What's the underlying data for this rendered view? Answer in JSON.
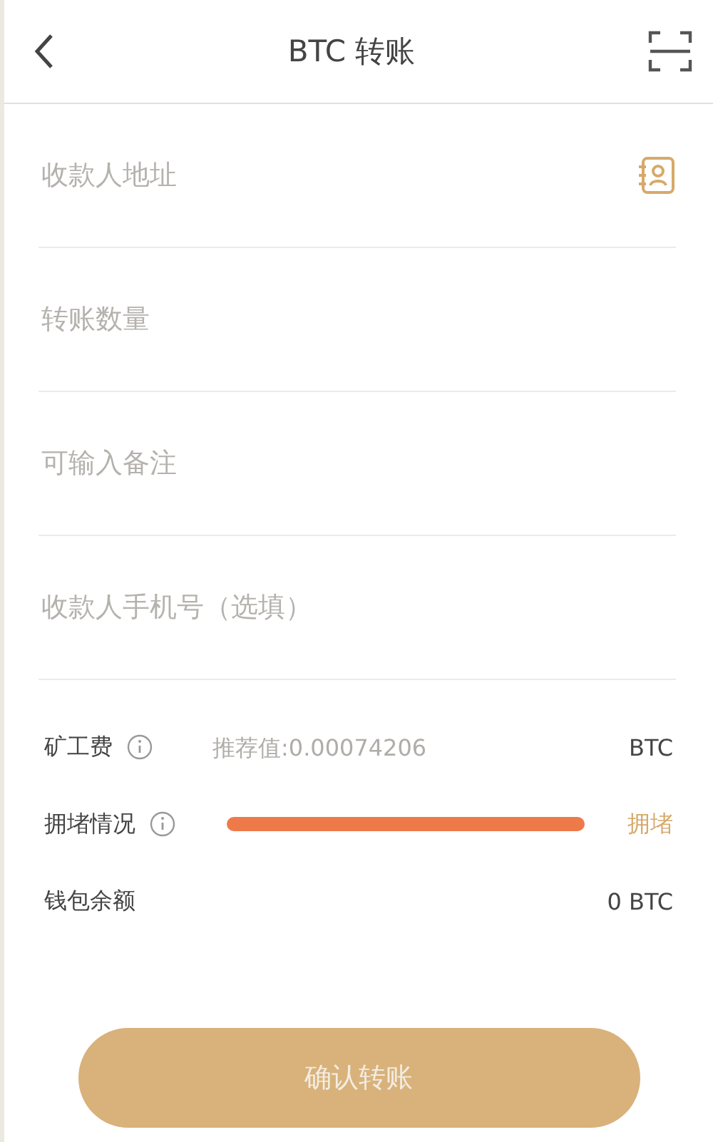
{
  "header": {
    "title": "BTC 转账"
  },
  "fields": [
    {
      "placeholder": "收款人地址",
      "kind": "address"
    },
    {
      "placeholder": "转账数量",
      "kind": "text"
    },
    {
      "placeholder": "可输入备注",
      "kind": "text"
    },
    {
      "placeholder": "收款人手机号（选填）",
      "kind": "text"
    }
  ],
  "fee": {
    "label": "矿工费",
    "placeholder": "推荐值:0.00074206",
    "unit": "BTC"
  },
  "congestion": {
    "label": "拥堵情况",
    "status": "拥堵"
  },
  "balance": {
    "label": "钱包余额",
    "value": "0 BTC"
  },
  "confirm_button": {
    "label": "确认转账",
    "disabled": true
  }
}
